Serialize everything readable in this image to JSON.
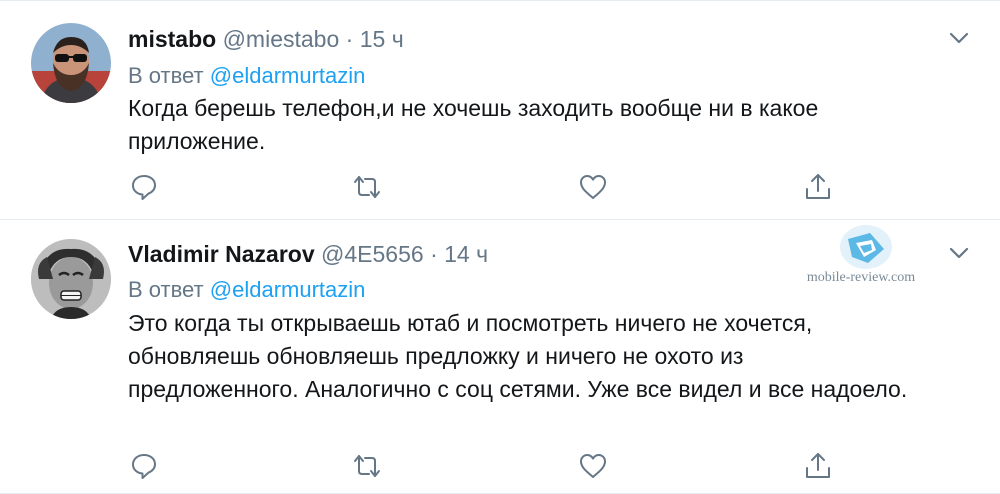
{
  "tweets": [
    {
      "author_name": "mistabo",
      "handle": "@miestabo",
      "time": "15 ч",
      "reply_prefix": "В ответ",
      "reply_mention": "@eldarmurtazin",
      "text": "Когда берешь телефон,и не хочешь заходить вообще ни в какое приложение."
    },
    {
      "author_name": "Vladimir Nazarov",
      "handle": "@4E5656",
      "time": "14 ч",
      "reply_prefix": "В ответ",
      "reply_mention": "@eldarmurtazin",
      "text": "Это когда ты открываешь ютаб и посмотреть ничего не хочется, обновляешь обновляешь предложку и ничего не охото из предложенного. Аналогично с соц сетями. Уже все видел и все надоело."
    }
  ],
  "watermark": {
    "text": "mobile-review.com"
  },
  "icons": [
    "chevron-down-icon",
    "reply-icon",
    "retweet-icon",
    "like-icon",
    "share-icon"
  ],
  "colors": {
    "accent": "#1da1f2",
    "text": "#14171a",
    "muted": "#657786",
    "divider": "#e6ecf0"
  }
}
